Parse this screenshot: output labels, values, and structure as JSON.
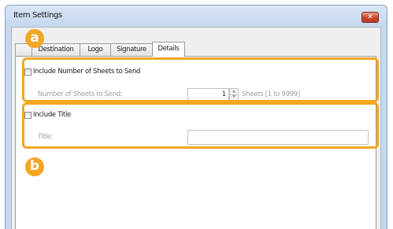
{
  "window": {
    "title": "Item Settings",
    "close_glyph": "✕"
  },
  "tabs": [
    {
      "label": ""
    },
    {
      "label": "Destination"
    },
    {
      "label": "Logo"
    },
    {
      "label": "Signature"
    },
    {
      "label": "Details",
      "active": true
    }
  ],
  "sheets_section": {
    "checkbox_label": "Include Number of Sheets to Send",
    "checked": false,
    "field_label": "Number of Sheets to Send:",
    "value": "1",
    "range_label": "Sheets [1 to 9999]"
  },
  "title_section": {
    "checkbox_label": "Include Title",
    "checked": false,
    "field_label": "Title:",
    "value": ""
  },
  "callouts": {
    "a": "a",
    "b": "b"
  },
  "colors": {
    "highlight": "#f5a623",
    "close_button": "#c8452a",
    "title_bar": "#c7d8ef"
  }
}
